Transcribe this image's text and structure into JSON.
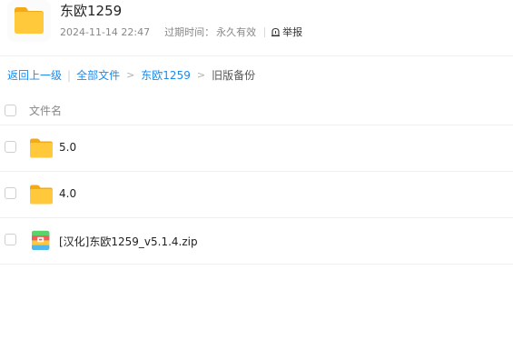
{
  "share": {
    "title": "东欧1259",
    "date": "2024-11-14 22:47",
    "expire_label": "过期时间：",
    "expire_value": "永久有效",
    "report_label": "举报"
  },
  "breadcrumb": {
    "back": "返回上一级",
    "all_files": "全部文件",
    "folder": "东欧1259",
    "current": "旧版备份",
    "separator": ">"
  },
  "list": {
    "header_name": "文件名",
    "rows": [
      {
        "name": "5.0",
        "icon": "folder-icon"
      },
      {
        "name": "4.0",
        "icon": "folder-icon"
      },
      {
        "name": "[汉化]东欧1259_v5.1.4.zip",
        "icon": "zip-archive-icon"
      }
    ]
  },
  "colors": {
    "link": "#1a8cf0",
    "folder_yellow": "#ffc93b",
    "divider": "#f0f0f0"
  }
}
